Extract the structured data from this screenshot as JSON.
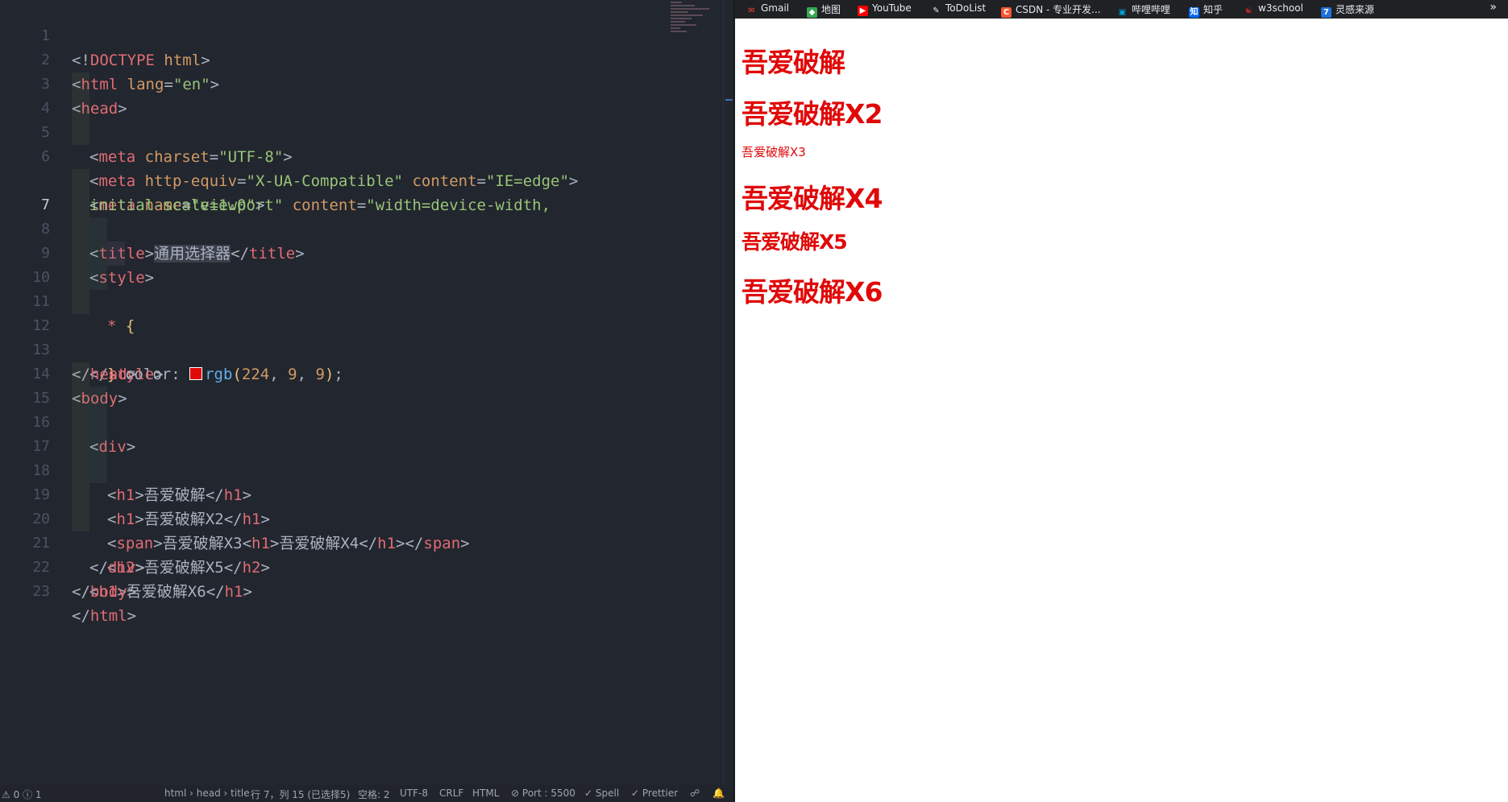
{
  "editor": {
    "active_line": "7",
    "line_numbers": [
      "1",
      "2",
      "3",
      "4",
      "5",
      "6",
      "",
      "7",
      "8",
      "9",
      "10",
      "11",
      "12",
      "13",
      "14",
      "15",
      "16",
      "17",
      "18",
      "19",
      "20",
      "21",
      "22",
      "23"
    ],
    "tokens": {
      "l1_open": "<!",
      "l1_doctype": "DOCTYPE",
      "l1_html": "html",
      "l1_close": ">",
      "l2_lt": "<",
      "l2_tag": "html",
      "l2_attr": "lang",
      "l2_eq": "=",
      "l2_val": "\"en\"",
      "l2_gt": ">",
      "l3_lt": "<",
      "l3_tag": "head",
      "l3_gt": ">",
      "l4_lt": "<",
      "l4_tag": "meta",
      "l4_attr": "charset",
      "l4_eq": "=",
      "l4_val": "\"UTF-8\"",
      "l4_gt": ">",
      "l5_lt": "<",
      "l5_tag": "meta",
      "l5_attr1": "http-equiv",
      "l5_eq1": "=",
      "l5_val1": "\"X-UA-Compatible\"",
      "l5_attr2": "content",
      "l5_eq2": "=",
      "l5_val2": "\"IE=edge\"",
      "l5_gt": ">",
      "l6_lt": "<",
      "l6_tag": "meta",
      "l6_attr1": "name",
      "l6_eq1": "=",
      "l6_val1": "\"viewport\"",
      "l6_attr2": "content",
      "l6_eq2": "=",
      "l6_val2": "\"width=device-width,",
      "l6b_val": "initial-scale=1.0\"",
      "l6b_gt": ">",
      "l7_lt": "<",
      "l7_tag": "title",
      "l7_gt": ">",
      "l7_text": "通用选择器",
      "l7_close_lt": "</",
      "l7_close_tag": "title",
      "l7_close_gt": ">",
      "l8_lt": "<",
      "l8_tag": "style",
      "l8_gt": ">",
      "l9_sel": "*",
      "l9_brace": "{",
      "l10_prop": "color",
      "l10_colon": ":",
      "l10_fn": "rgb",
      "l10_open": "(",
      "l10_n1": "224",
      "l10_c1": ",",
      "l10_n2": "9",
      "l10_c2": ",",
      "l10_n3": "9",
      "l10_close": ")",
      "l10_semi": ";",
      "l11_brace": "}",
      "l12_lt": "</",
      "l12_tag": "style",
      "l12_gt": ">",
      "l13_lt": "</",
      "l13_tag": "head",
      "l13_gt": ">",
      "l14_lt": "<",
      "l14_tag": "body",
      "l14_gt": ">",
      "l15_lt": "<",
      "l15_tag": "div",
      "l15_gt": ">",
      "l16_lt": "<",
      "l16_tag": "h1",
      "l16_gt": ">",
      "l16_text": "吾爱破解",
      "l16_clt": "</",
      "l16_ctag": "h1",
      "l16_cgt": ">",
      "l17_lt": "<",
      "l17_tag": "h1",
      "l17_gt": ">",
      "l17_text": "吾爱破解X2",
      "l17_clt": "</",
      "l17_ctag": "h1",
      "l17_cgt": ">",
      "l18_lt": "<",
      "l18_tag": "span",
      "l18_gt": ">",
      "l18_text1": "吾爱破解X3",
      "l18_lt2": "<",
      "l18_tag2": "h1",
      "l18_gt2": ">",
      "l18_text2": "吾爱破解X4",
      "l18_clt2": "</",
      "l18_ctag2": "h1",
      "l18_cgt2": ">",
      "l18_clt": "</",
      "l18_ctag": "span",
      "l18_cgt": ">",
      "l19_lt": "<",
      "l19_tag": "h2",
      "l19_gt": ">",
      "l19_text": "吾爱破解X5",
      "l19_clt": "</",
      "l19_ctag": "h2",
      "l19_cgt": ">",
      "l20_lt": "</",
      "l20_tag": "div",
      "l20_gt": ">",
      "l21_lt": "<",
      "l21_tag": "h1",
      "l21_gt": ">",
      "l21_text": "吾爱破解X6",
      "l21_clt": "</",
      "l21_ctag": "h1",
      "l21_cgt": ">",
      "l22_lt": "</",
      "l22_tag": "body",
      "l22_gt": ">",
      "l23_lt": "</",
      "l23_tag": "html",
      "l23_gt": ">"
    },
    "swatch_color": "#e00909"
  },
  "statusbar": {
    "problems": "0",
    "info": "1",
    "breadcrumb": "html › head › title",
    "cursor": "行 7，列 15 (已选择5)",
    "spaces": "空格: 2",
    "encoding": "UTF-8",
    "eol": "CRLF",
    "language": "HTML",
    "port": "Port : 5500",
    "spell": "Spell",
    "prettier": "Prettier"
  },
  "browser": {
    "bookmarks": [
      {
        "label": "Gmail",
        "icon": "gmail-icon",
        "color": "#ea4335"
      },
      {
        "label": "地图",
        "icon": "maps-icon",
        "color": "#34a853"
      },
      {
        "label": "YouTube",
        "icon": "youtube-icon",
        "color": "#ff0000"
      },
      {
        "label": "ToDoList",
        "icon": "pen-icon",
        "color": "#e8eaed"
      },
      {
        "label": "CSDN - 专业开发...",
        "icon": "csdn-icon",
        "color": "#fc5531"
      },
      {
        "label": "哔哩哔哩",
        "icon": "bilibili-icon",
        "color": "#00a1d6"
      },
      {
        "label": "知乎",
        "icon": "zhihu-icon",
        "color": "#0066ff"
      },
      {
        "label": "w3school",
        "icon": "w3school-icon",
        "color": "#c62828"
      },
      {
        "label": "灵感来源",
        "icon": "lingan-icon",
        "color": "#1e6fd9"
      }
    ],
    "more": "»",
    "page": {
      "h1_1": "吾爱破解",
      "h1_2": "吾爱破解X2",
      "span_3": "吾爱破解X3",
      "h1_4": "吾爱破解X4",
      "h2_5": "吾爱破解X5",
      "h1_6": "吾爱破解X6",
      "text_color": "rgb(224, 9, 9)"
    }
  }
}
